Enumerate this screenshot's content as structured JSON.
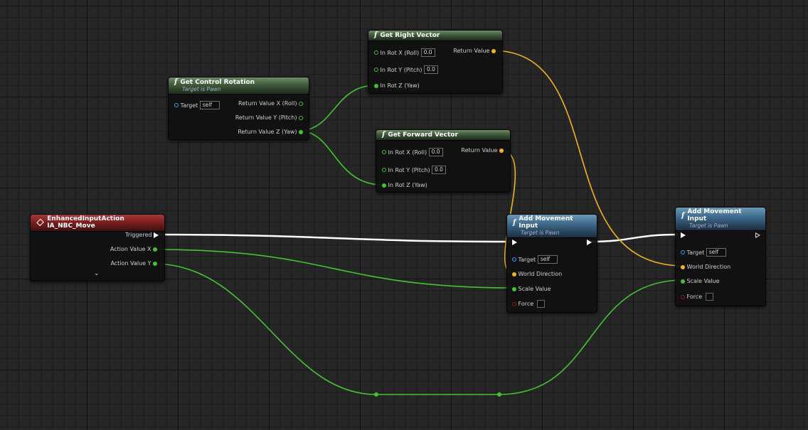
{
  "nodes": {
    "get_right_vector": {
      "title": "Get Right Vector",
      "inputs": [
        {
          "label": "In Rot X (Roll)",
          "value": "0.0"
        },
        {
          "label": "In Rot Y (Pitch)",
          "value": "0.0"
        },
        {
          "label": "In Rot Z (Yaw)"
        }
      ],
      "output": "Return Value"
    },
    "get_control_rotation": {
      "title": "Get Control Rotation",
      "subtitle": "Target is Pawn",
      "target_label": "Target",
      "target_value": "self",
      "outputs": [
        "Return Value X (Roll)",
        "Return Value Y (Pitch)",
        "Return Value Z (Yaw)"
      ]
    },
    "get_forward_vector": {
      "title": "Get Forward Vector",
      "inputs": [
        {
          "label": "In Rot X (Roll)",
          "value": "0.0"
        },
        {
          "label": "In Rot Y (Pitch)",
          "value": "0.0"
        },
        {
          "label": "In Rot Z (Yaw)"
        }
      ],
      "output": "Return Value"
    },
    "input_action": {
      "title": "EnhancedInputAction IA_NBC_Move",
      "outputs": [
        "Triggered",
        "Action Value X",
        "Action Value Y"
      ]
    },
    "add_movement_1": {
      "title": "Add Movement Input",
      "subtitle": "Target is Pawn",
      "target_label": "Target",
      "target_value": "self",
      "world_direction": "World Direction",
      "scale_value": "Scale Value",
      "force": "Force"
    },
    "add_movement_2": {
      "title": "Add Movement Input",
      "subtitle": "Target is Pawn",
      "target_label": "Target",
      "target_value": "self",
      "world_direction": "World Direction",
      "scale_value": "Scale Value",
      "force": "Force"
    }
  },
  "colors": {
    "exec_wire": "#ffffff",
    "float_wire": "#44c232",
    "vector_wire": "#f2b320",
    "pure_header": "#4f6b48",
    "call_header": "#3b6586",
    "event_header": "#8b2424"
  }
}
